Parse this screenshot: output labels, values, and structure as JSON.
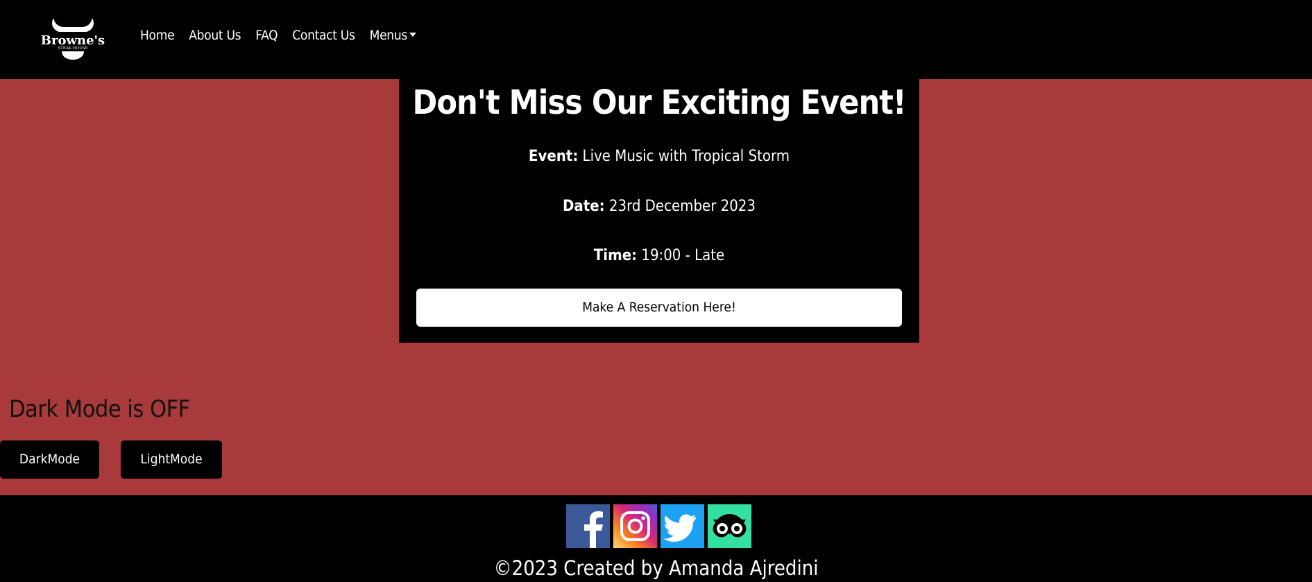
{
  "nav": {
    "logo_text": "Browne's",
    "logo_subtext": "STEAK HOUSE",
    "links": [
      "Home",
      "About Us",
      "FAQ",
      "Contact Us"
    ],
    "menus_label": "Menus"
  },
  "event": {
    "title": "Don't Miss Our Exciting Event!",
    "event_label": "Event:",
    "event_value": "Live Music with Tropical Storm",
    "date_label": "Date:",
    "date_value": "23rd December 2023",
    "time_label": "Time:",
    "time_value": "19:00 - Late",
    "reserve_button": "Make A Reservation Here!"
  },
  "mode": {
    "status": "Dark Mode is OFF",
    "dark_button": "DarkMode",
    "light_button": "LightMode"
  },
  "footer": {
    "social": [
      "facebook-icon",
      "instagram-icon",
      "twitter-icon",
      "tripadvisor-icon"
    ],
    "copyright": "©2023 Created by Amanda Ajredini"
  },
  "colors": {
    "page_background": "#a83a3b",
    "navbar": "#000000",
    "facebook": "#3b5998",
    "twitter": "#1da1f2",
    "tripadvisor": "#34e0a1"
  }
}
